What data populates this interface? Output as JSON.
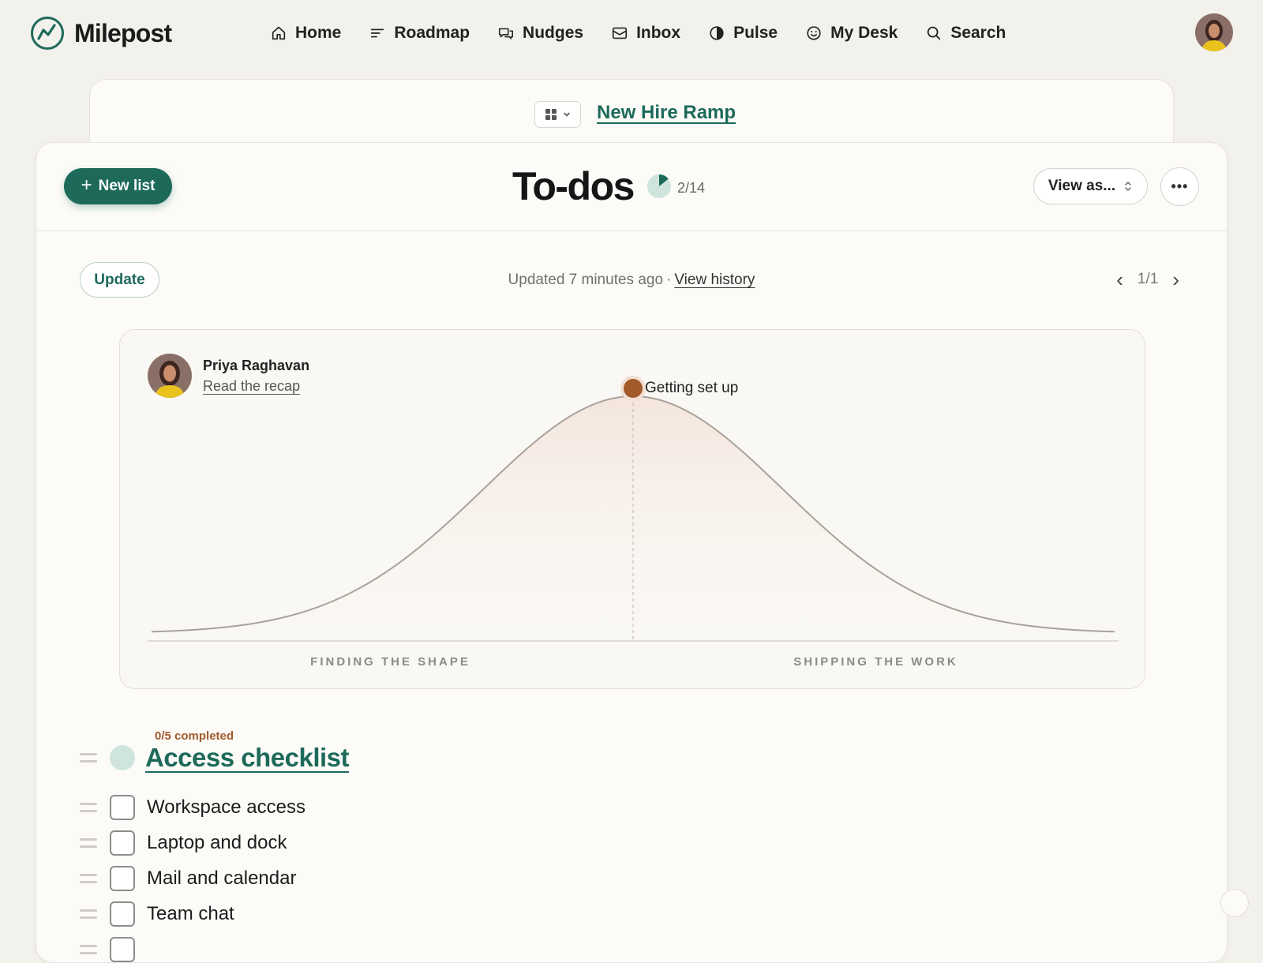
{
  "app": {
    "name": "Milepost",
    "logo_icon": "milepost-logo-icon",
    "brand_color": "#1d6a5a"
  },
  "nav": {
    "items": [
      {
        "label": "Home",
        "icon": "home-icon"
      },
      {
        "label": "Roadmap",
        "icon": "roadmap-icon"
      },
      {
        "label": "Nudges",
        "icon": "chat-bubbles-icon"
      },
      {
        "label": "Inbox",
        "icon": "inbox-icon"
      },
      {
        "label": "Pulse",
        "icon": "half-circle-icon"
      },
      {
        "label": "My Desk",
        "icon": "smiley-icon"
      },
      {
        "label": "Search",
        "icon": "search-icon"
      }
    ]
  },
  "project": {
    "name": "New Hire Ramp",
    "switcher_icon": "grid-icon"
  },
  "header": {
    "new_list_label": "New list",
    "title": "To-dos",
    "progress_text": "2/14",
    "progress_fraction": 0.142857,
    "view_as_label": "View as...",
    "more_label": "•••"
  },
  "update_bar": {
    "update_label": "Update",
    "updated_text": "Updated 7 minutes ago",
    "separator": "·",
    "view_history_label": "View history",
    "page_indicator": "1/1",
    "prev_icon": "‹",
    "next_icon": "›"
  },
  "hill_chart": {
    "person_name": "Priya Raghavan",
    "recap_link": "Read the recap",
    "left_phase_label": "FINDING THE SHAPE",
    "right_phase_label": "SHIPPING THE WORK",
    "dot_label": "Getting set up",
    "dot_position": 0.5,
    "dot_color": "#a35a2b",
    "curve_color": "#a8a29b"
  },
  "list": {
    "completion_text": "0/5 completed",
    "title": "Access checklist",
    "items": [
      {
        "label": "Workspace access",
        "checked": false
      },
      {
        "label": "Laptop and dock",
        "checked": false
      },
      {
        "label": "Mail and calendar",
        "checked": false
      },
      {
        "label": "Team chat",
        "checked": false
      }
    ]
  }
}
